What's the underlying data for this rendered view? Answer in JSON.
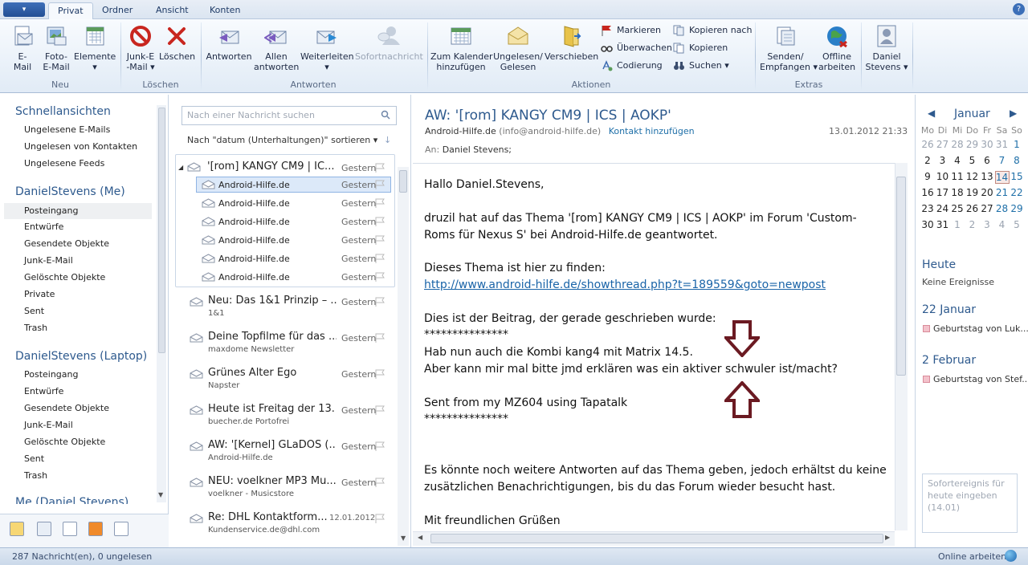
{
  "ribbon": {
    "app_button_label": "▾",
    "tabs": [
      "Privat",
      "Ordner",
      "Ansicht",
      "Konten"
    ],
    "active_tab": "Privat",
    "help_label": "?",
    "groups": {
      "neu": {
        "label": "Neu",
        "buttons": [
          "E-\nMail",
          "Foto-\nE-Mail",
          "Elemente\n▾"
        ]
      },
      "loeschen": {
        "label": "Löschen",
        "buttons": [
          "Junk-E\n-Mail ▾",
          "Löschen"
        ]
      },
      "antworten": {
        "label": "Antworten",
        "buttons": [
          "Antworten",
          "Allen\nantworten",
          "Weiterleiten\n▾",
          "Sofortnachricht"
        ]
      },
      "aktionen": {
        "label": "Aktionen",
        "buttons": [
          "Zum Kalender\nhinzufügen",
          "Ungelesen/\nGelesen",
          "Verschieben"
        ],
        "small": [
          "Markieren",
          "Überwachen",
          "Codierung",
          "Kopieren nach",
          "Kopieren",
          "Suchen ▾"
        ]
      },
      "extras": {
        "label": "Extras",
        "buttons": [
          "Senden/\nEmpfangen ▾",
          "Offline\narbeiten"
        ]
      },
      "account": {
        "buttons": [
          "Daniel\nStevens ▾"
        ]
      }
    }
  },
  "nav": {
    "sections": [
      {
        "title": "Schnellansichten",
        "items": [
          "Ungelesene E-Mails",
          "Ungelesen von Kontakten",
          "Ungelesene Feeds"
        ]
      },
      {
        "title": "DanielStevens (Me)",
        "items": [
          "Posteingang",
          "Entwürfe",
          "Gesendete Objekte",
          "Junk-E-Mail",
          "Gelöschte Objekte",
          "Private",
          "Sent",
          "Trash"
        ]
      },
      {
        "title": "DanielStevens (Laptop)",
        "items": [
          "Posteingang",
          "Entwürfe",
          "Gesendete Objekte",
          "Junk-E-Mail",
          "Gelöschte Objekte",
          "Sent",
          "Trash"
        ]
      },
      {
        "title": "Me (Daniel Stevens)",
        "items": []
      }
    ],
    "selected": "Posteingang"
  },
  "list": {
    "search_placeholder": "Nach einer Nachricht suchen",
    "sort_label": "Nach \"datum (Unterhaltungen)\" sortieren ▾",
    "sort_dir": "↓",
    "thread": {
      "subject": "'[rom] KANGY CM9 | IC...",
      "date": "Gestern",
      "children": [
        {
          "sender": "Android-Hilfe.de",
          "date": "Gestern"
        },
        {
          "sender": "Android-Hilfe.de",
          "date": "Gestern"
        },
        {
          "sender": "Android-Hilfe.de",
          "date": "Gestern"
        },
        {
          "sender": "Android-Hilfe.de",
          "date": "Gestern"
        },
        {
          "sender": "Android-Hilfe.de",
          "date": "Gestern"
        },
        {
          "sender": "Android-Hilfe.de",
          "date": "Gestern"
        }
      ]
    },
    "messages": [
      {
        "subject": "Neu: Das 1&1 Prinzip – ...",
        "sender": "1&1",
        "date": "Gestern"
      },
      {
        "subject": "Deine Topfilme für das ...",
        "sender": "maxdome Newsletter",
        "date": "Gestern"
      },
      {
        "subject": "Grünes Alter Ego",
        "sender": "Napster",
        "date": "Gestern"
      },
      {
        "subject": "Heute ist Freitag der 13.",
        "sender": "buecher.de Portofrei",
        "date": "Gestern"
      },
      {
        "subject": "AW: '[Kernel] GLaDOS (...",
        "sender": "Android-Hilfe.de",
        "date": "Gestern"
      },
      {
        "subject": "NEU: voelkner MP3 Mu...",
        "sender": "voelkner - Musicstore",
        "date": "Gestern"
      },
      {
        "subject": "Re: DHL Kontaktform...",
        "sender": "Kundenservice.de@dhl.com",
        "date": "12.01.2012"
      }
    ]
  },
  "reading": {
    "subject": "AW: '[rom] KANGY CM9 | ICS | AOKP'",
    "from_name": "Android-Hilfe.de",
    "from_email": "(info@android-hilfe.de)",
    "add_contact": "Kontakt hinzufügen",
    "sent": "13.01.2012 21:33",
    "to_label": "An:",
    "to_value": "Daniel Stevens;",
    "body": {
      "l1": "Hallo Daniel.Stevens,",
      "l2": "druzil hat auf das Thema '[rom] KANGY CM9 | ICS | AOKP' im Forum 'Custom-",
      "l3": "Roms für Nexus S' bei Android-Hilfe.de geantwortet.",
      "l4": "Dieses Thema ist hier zu finden:",
      "link": "http://www.android-hilfe.de/showthread.php?t=189559&goto=newpost",
      "l5": "Dies ist der Beitrag, der gerade geschrieben wurde:",
      "stars1": "***************",
      "l6": "Hab nun auch die Kombi kang4 mit Matrix 14.5.",
      "l7": "Aber kann mir mal bitte jmd erklären was ein aktiver schwuler ist/macht?",
      "l8": "Sent from my MZ604 using Tapatalk",
      "stars2": "***************",
      "l9": "Es könnte noch weitere Antworten auf das Thema geben, jedoch erhältst du keine",
      "l10": "zusätzlichen Benachrichtigungen, bis du das Forum wieder besucht hast.",
      "l11": "Mit freundlichen Grüßen"
    }
  },
  "todo": {
    "calendar": {
      "month": "Januar",
      "weekdays": [
        "Mo",
        "Di",
        "Mi",
        "Do",
        "Fr",
        "Sa",
        "So"
      ],
      "weeks": [
        [
          "26",
          "27",
          "28",
          "29",
          "30",
          "31",
          "1"
        ],
        [
          "2",
          "3",
          "4",
          "5",
          "6",
          "7",
          "8"
        ],
        [
          "9",
          "10",
          "11",
          "12",
          "13",
          "14",
          "15"
        ],
        [
          "16",
          "17",
          "18",
          "19",
          "20",
          "21",
          "22"
        ],
        [
          "23",
          "24",
          "25",
          "26",
          "27",
          "28",
          "29"
        ],
        [
          "30",
          "31",
          "1",
          "2",
          "3",
          "4",
          "5"
        ]
      ],
      "today": "14"
    },
    "heute_title": "Heute",
    "heute_text": "Keine Ereignisse",
    "sections": [
      {
        "title": "22 Januar",
        "event": "Geburtstag von Luk..."
      },
      {
        "title": "2 Februar",
        "event": "Geburtstag von Stef..."
      }
    ],
    "quick_placeholder": "Sofortereignis für heute eingeben (14.01)"
  },
  "status": {
    "left": "287 Nachricht(en), 0 ungelesen",
    "right": "Online arbeiten"
  },
  "colors": {
    "accent": "#2e5a8e",
    "annotation_arrow": "#6b1a22"
  }
}
